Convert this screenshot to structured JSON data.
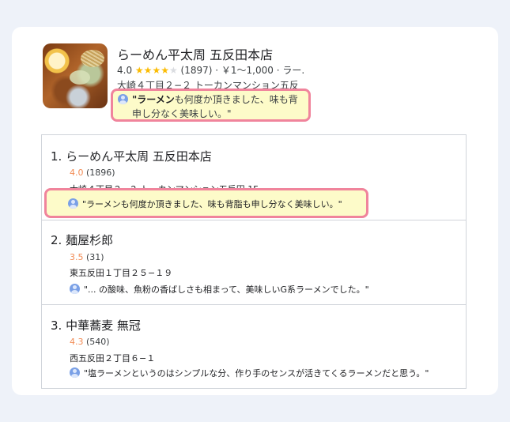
{
  "top_result": {
    "name": "らーめん平太周 五反田本店",
    "rating": "4.0",
    "stars": "★★★★",
    "star_empty": "★",
    "reviews": "(1897)",
    "meta": "· ￥1～1,000 · ラー.",
    "address": "大崎４丁目２−２ トーカンマンション五反",
    "review_bold": "\"ラーメン",
    "review_rest": "も何度か頂きました、味も背",
    "review_line2": "申し分なく美味しい。\""
  },
  "results": [
    {
      "title": "1. らーめん平太周 五反田本店",
      "rating": "4.0",
      "count": "(1896)",
      "address": "大崎４丁目２−２ トーカンマンション五反田 1F",
      "review": "\"ラーメンも何度か頂きました、味も背脂も申し分なく美味しい。\""
    },
    {
      "title": "2. 麺屋杉郎",
      "rating": "3.5",
      "count": "(31)",
      "address": "東五反田１丁目２５−１９",
      "review": "\"... の酸味、魚粉の香ばしさも相まって、美味しいG系ラーメンでした。\""
    },
    {
      "title": "3. 中華蕎麦 無冠",
      "rating": "4.3",
      "count": "(540)",
      "address": "西五反田２丁目６−１",
      "review": "\"塩ラーメンというのはシンプルな分、作り手のセンスが活きてくるラーメンだと思う。\""
    }
  ],
  "colors": {
    "highlight_fill": "#fdfbc9",
    "highlight_border": "#f0849c",
    "rating_orange": "#f28b54",
    "star_yellow": "#fbbc04"
  },
  "icons": [
    "user-avatar-icon",
    "star-icon"
  ]
}
